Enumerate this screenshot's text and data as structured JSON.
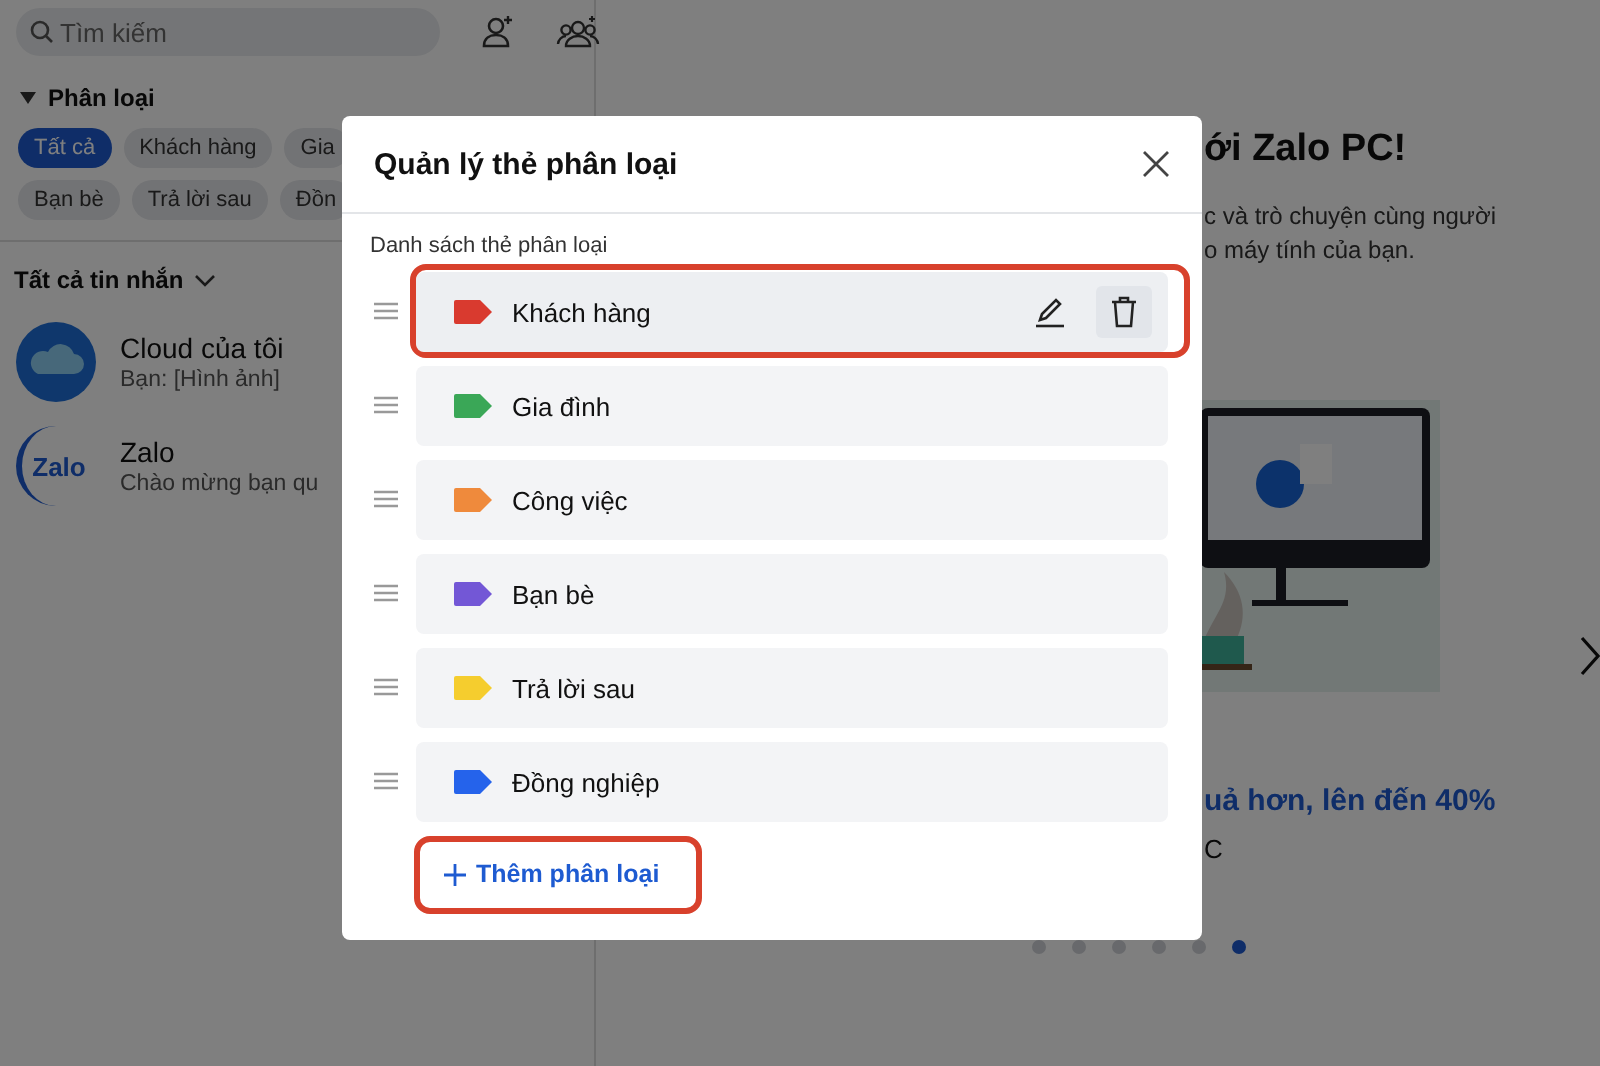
{
  "sidebar": {
    "search": {
      "placeholder": "Tìm kiếm"
    },
    "section_title": "Phân loại",
    "filter_rows": [
      [
        {
          "label": "Tất cả",
          "selected": true
        },
        {
          "label": "Khách hàng",
          "selected": false
        },
        {
          "label": "Gia",
          "selected": false
        }
      ],
      [
        {
          "label": "Bạn bè",
          "selected": false
        },
        {
          "label": "Trả lời sau",
          "selected": false
        },
        {
          "label": "Đồn",
          "selected": false
        }
      ]
    ],
    "messages_filter": "Tất cả tin nhắn",
    "conversations": [
      {
        "kind": "cloud",
        "name": "Cloud của tôi",
        "preview": "Bạn: [Hình ảnh]"
      },
      {
        "kind": "zalo",
        "logo_text": "Zalo",
        "name": "Zalo",
        "preview": "Chào mừng bạn qu"
      }
    ]
  },
  "main": {
    "title": "ới Zalo PC!",
    "text_lines": [
      "c và trò chuyện cùng người",
      "o máy tính của bạn."
    ],
    "promo": "uả hơn, lên đến 40%",
    "promo_tail": "C",
    "slides": [
      {
        "selected": false
      },
      {
        "selected": false
      },
      {
        "selected": false
      },
      {
        "selected": false
      },
      {
        "selected": false
      },
      {
        "selected": true
      }
    ]
  },
  "dialog": {
    "title": "Quản lý thẻ phân loại",
    "list_label": "Danh sách thẻ phân loại",
    "tags": [
      {
        "name": "Khách hàng",
        "color": "#d93a2f",
        "highlighted": true,
        "hovered": true
      },
      {
        "name": "Gia đình",
        "color": "#3aa757",
        "highlighted": false,
        "hovered": false
      },
      {
        "name": "Công việc",
        "color": "#ef8a3c",
        "highlighted": false,
        "hovered": false
      },
      {
        "name": "Bạn bè",
        "color": "#7357d6",
        "highlighted": false,
        "hovered": false
      },
      {
        "name": "Trả lời sau",
        "color": "#f5cd2e",
        "highlighted": false,
        "hovered": false
      },
      {
        "name": "Đồng nghiệp",
        "color": "#2563eb",
        "highlighted": false,
        "hovered": false
      }
    ],
    "add_button": {
      "label": "Thêm phân loại",
      "highlighted": true
    }
  }
}
